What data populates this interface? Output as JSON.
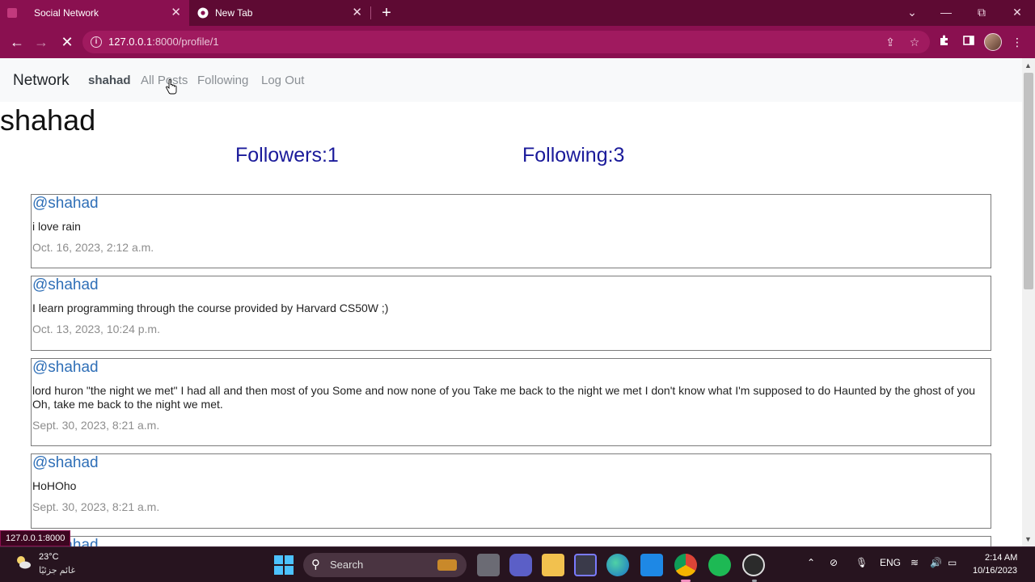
{
  "browser": {
    "tabs": [
      {
        "title": "Social Network",
        "active": true
      },
      {
        "title": "New Tab",
        "active": false
      }
    ],
    "tab_close_glyph": "✕",
    "new_tab_glyph": "+",
    "window_controls": {
      "dropdown": "⌄",
      "minimize": "—",
      "restore": "⧉",
      "close": "✕"
    },
    "nav": {
      "back": "←",
      "forward": "→",
      "reload": "✕"
    },
    "address": {
      "host": "127.0.0.1",
      "path": ":8000/profile/1"
    },
    "status_url": "127.0.0.1:8000",
    "colors": {
      "tabstrip": "#5e0a33",
      "toolbar": "#8a1050"
    }
  },
  "navbar": {
    "brand": "Network",
    "user": "shahad",
    "links": [
      "All Posts",
      "Following",
      "Log Out"
    ]
  },
  "profile": {
    "name": "shahad",
    "followers_label": "Followers:1",
    "following_label": "Following:3"
  },
  "posts": [
    {
      "author": "@shahad",
      "content": "i love rain",
      "timestamp": "Oct. 16, 2023, 2:12 a.m."
    },
    {
      "author": "@shahad",
      "content": "I learn programming through the course provided by Harvard CS50W ;)",
      "timestamp": "Oct. 13, 2023, 10:24 p.m."
    },
    {
      "author": "@shahad",
      "content": "lord huron \"the night we met\" I had all and then most of you Some and now none of you Take me back to the night we met I don't know what I'm supposed to do Haunted by the ghost of you Oh, take me back to the night we met.",
      "timestamp": "Sept. 30, 2023, 8:21 a.m."
    },
    {
      "author": "@shahad",
      "content": "HoHOho",
      "timestamp": "Sept. 30, 2023, 8:21 a.m."
    },
    {
      "author": "@shahad",
      "content": "",
      "timestamp": ""
    }
  ],
  "taskbar": {
    "weather_temp": "23°C",
    "weather_desc": "غائم جزئيًا",
    "search_label": "Search",
    "language": "ENG",
    "time": "2:14 AM",
    "date": "10/16/2023"
  }
}
